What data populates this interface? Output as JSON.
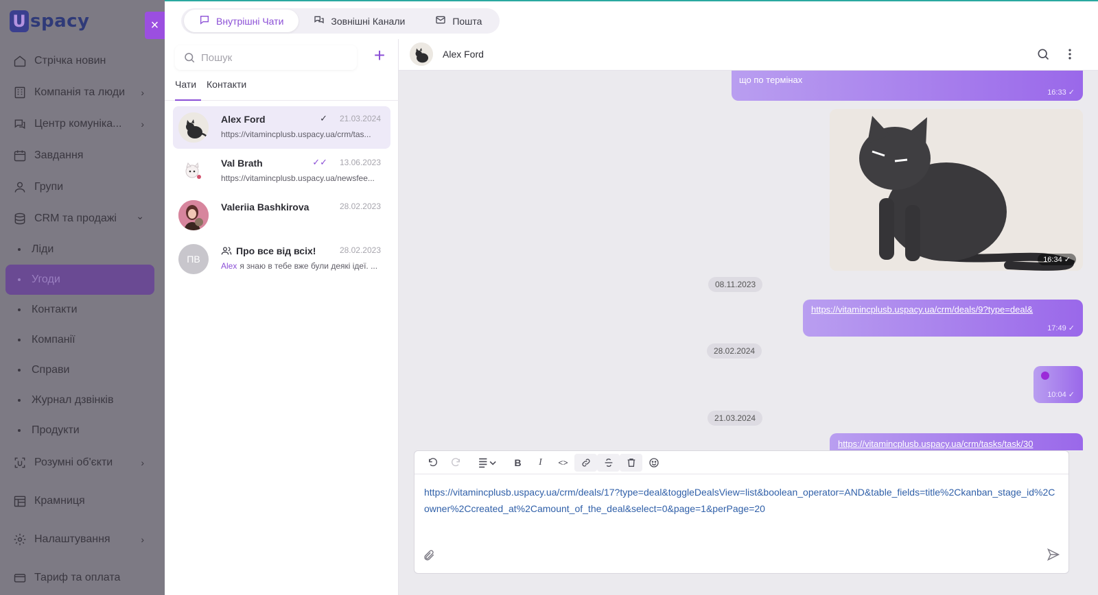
{
  "app": {
    "logo_u": "U",
    "logo_rest": "spacy",
    "close_icon": "×"
  },
  "nav": {
    "items": [
      {
        "label": "Стрічка новин",
        "icon": "home-icon"
      },
      {
        "label": "Компанія та люди",
        "icon": "company-icon",
        "chevron": "›"
      },
      {
        "label": "Центр комуніка...",
        "icon": "communication-icon",
        "chevron": "›"
      },
      {
        "label": "Завдання",
        "icon": "calendar-icon"
      },
      {
        "label": "Групи",
        "icon": "user-icon"
      },
      {
        "label": "CRM та продажі",
        "icon": "database-icon",
        "chevron": "⌄"
      }
    ],
    "sub_items": [
      "Ліди",
      "Угоди",
      "Контакти",
      "Компанії",
      "Справи",
      "Журнал дзвінків",
      "Продукти"
    ],
    "bottom_items": [
      {
        "label": "Розумні об'єкти",
        "icon": "smart-object-icon",
        "chevron": "›"
      },
      {
        "label": "Крамниця",
        "icon": "store-icon"
      },
      {
        "label": "Налаштування",
        "icon": "gear-icon",
        "chevron": "›"
      },
      {
        "label": "Тариф та оплата",
        "icon": "card-icon"
      }
    ]
  },
  "top_tabs": {
    "internal": "Внутрішні Чати",
    "external": "Зовнішні Канали",
    "mail": "Пошта"
  },
  "chat_list": {
    "search_placeholder": "Пошук",
    "add_label": "+",
    "tab_chats": "Чати",
    "tab_contacts": "Контакти",
    "chats": [
      {
        "name": "Alex Ford",
        "date": "21.03.2024",
        "check": "✓",
        "preview": "https://vitamincplusb.uspacy.ua/crm/tas..."
      },
      {
        "name": "Val Brath",
        "date": "13.06.2023",
        "check": "✓✓",
        "preview": "https://vitamincplusb.uspacy.ua/newsfee..."
      },
      {
        "name": "Valeriia Bashkirova",
        "date": "28.02.2023",
        "preview": ""
      },
      {
        "name": "Про все від всіх!",
        "date": "28.02.2023",
        "initials": "ПВ",
        "preview_author": "Alex",
        "preview": "я знаю в тебе вже були деякі ідеї. ..."
      }
    ]
  },
  "conversation": {
    "title": "Alex Ford",
    "messages": {
      "m1_text": "що по термінах",
      "m1_time": "16:33",
      "image_time": "16:34",
      "date1": "08.11.2023",
      "m2_link": "https://vitamincplusb.uspacy.ua/crm/deals/9?type=deal&",
      "m2_time": "17:49",
      "date2": "28.02.2024",
      "m3_time": "10:04",
      "date3": "21.03.2024",
      "m4_link": "https://vitamincplusb.uspacy.ua/crm/tasks/task/30"
    }
  },
  "composer": {
    "text": "https://vitamincplusb.uspacy.ua/crm/deals/17?type=deal&toggleDealsView=list&boolean_operator=AND&table_fields=title%2Ckanban_stage_id%2Cowner%2Ccreated_at%2Camount_of_the_deal&select=0&page=1&perPage=20",
    "toolbar": {
      "bold": "B",
      "italic": "I",
      "code": "<>"
    }
  },
  "colors": {
    "accent": "#8b4fd6",
    "bubble_start": "#b99ef0",
    "bubble_end": "#9a68ea",
    "sidebar_dim": "#7d7a84"
  }
}
